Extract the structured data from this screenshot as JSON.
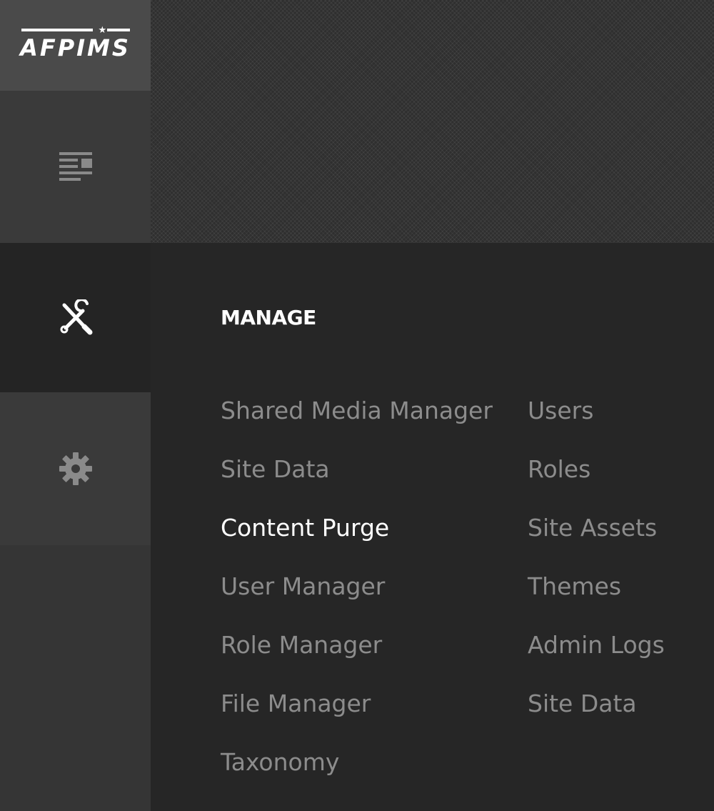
{
  "app": {
    "logo_text": "AFPIMS"
  },
  "rail": {
    "items": [
      {
        "id": "content",
        "icon": "news-icon"
      },
      {
        "id": "manage",
        "icon": "tools-icon",
        "active": true
      },
      {
        "id": "settings",
        "icon": "gear-icon"
      }
    ]
  },
  "panel": {
    "title": "MANAGE",
    "columns": [
      [
        {
          "label": "Shared Media Manager"
        },
        {
          "label": "Site Data"
        },
        {
          "label": "Content Purge",
          "active": true
        },
        {
          "label": "User Manager"
        },
        {
          "label": "Role Manager"
        },
        {
          "label": "File Manager"
        },
        {
          "label": "Taxonomy"
        }
      ],
      [
        {
          "label": "Users"
        },
        {
          "label": "Roles"
        },
        {
          "label": "Site Assets"
        },
        {
          "label": "Themes"
        },
        {
          "label": "Admin Logs"
        },
        {
          "label": "Site Data"
        }
      ]
    ]
  },
  "colors": {
    "rail_bg": "#333333",
    "logo_bg": "#4a4a4a",
    "panel_bg": "#262626",
    "menu_text": "#8c8c8c",
    "menu_text_active": "#ffffff"
  }
}
